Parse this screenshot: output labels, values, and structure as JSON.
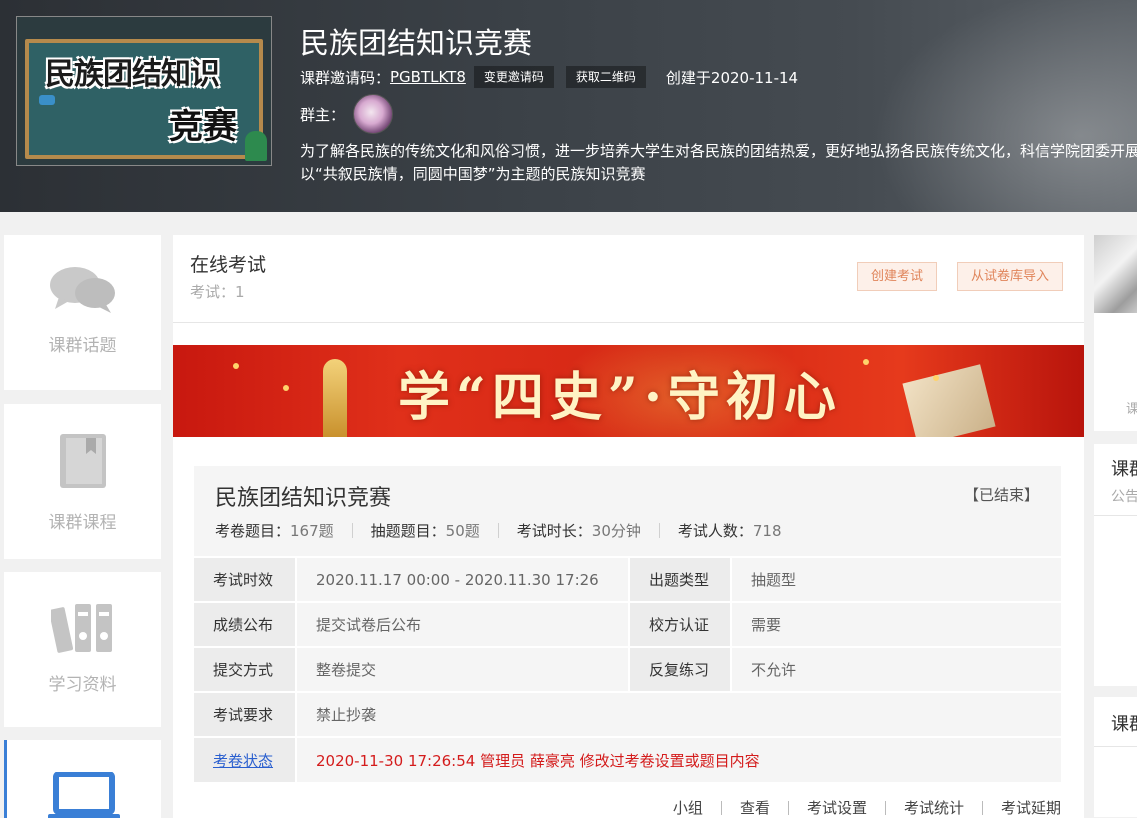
{
  "header": {
    "cover_text_line1": "民族团结知识",
    "cover_text_line2": "竞赛",
    "title": "民族团结知识竞赛",
    "invite_label": "课群邀请码：",
    "invite_code": "PGBTLKT8",
    "change_code_button": "变更邀请码",
    "qr_button": "获取二维码",
    "created": "创建于2020-11-14",
    "owner_label": "群主：",
    "description": "为了解各民族的传统文化和风俗习惯，进一步培养大学生对各民族的团结热爱，更好地弘扬各民族传统文化，科信学院团委开展以“共叙民族情，同圆中国梦”为主题的民族知识竞赛"
  },
  "sidebar": {
    "items": [
      {
        "label": "课群话题",
        "icon": "chat-bubbles-icon"
      },
      {
        "label": "课群课程",
        "icon": "book-icon"
      },
      {
        "label": "学习资料",
        "icon": "binders-icon"
      },
      {
        "label": "",
        "icon": "laptop-icon",
        "active": true
      }
    ]
  },
  "main": {
    "title": "在线考试",
    "count": "考试：1",
    "create_button": "创建考试",
    "import_button": "从试卷库导入",
    "banner_text": "学“四史”·守初心"
  },
  "exam": {
    "title": "民族团结知识竞赛",
    "status": "【已结束】",
    "stats": [
      {
        "label": "考卷题目：",
        "value": "167题"
      },
      {
        "label": "抽题题目：",
        "value": "50题"
      },
      {
        "label": "考试时长：",
        "value": "30分钟"
      },
      {
        "label": "考试人数：",
        "value": "718"
      }
    ],
    "rows": {
      "period_label": "考试时效",
      "period_value": "2020.11.17 00:00 - 2020.11.30 17:26",
      "qtype_label": "出题类型",
      "qtype_value": "抽题型",
      "score_label": "成绩公布",
      "score_value": "提交试卷后公布",
      "school_label": "校方认证",
      "school_value": "需要",
      "submit_label": "提交方式",
      "submit_value": "整卷提交",
      "repeat_label": "反复练习",
      "repeat_value": "不允许",
      "req_label": "考试要求",
      "req_value": "禁止抄袭",
      "paper_label": "考卷状态",
      "paper_value": "2020-11-30 17:26:54 管理员 薛豪亮 修改过考卷设置或题目内容"
    },
    "ops": [
      "小组",
      "查看",
      "考试设置",
      "考试统计",
      "考试延期"
    ]
  },
  "right": {
    "card1_char": "课",
    "card2_title": "课群",
    "card2_sub": "公告",
    "card3_title": "课群"
  },
  "colors": {
    "accent_blue": "#3a7fd6",
    "button_orange": "#e0855b",
    "alert_red": "#d41c1c"
  }
}
